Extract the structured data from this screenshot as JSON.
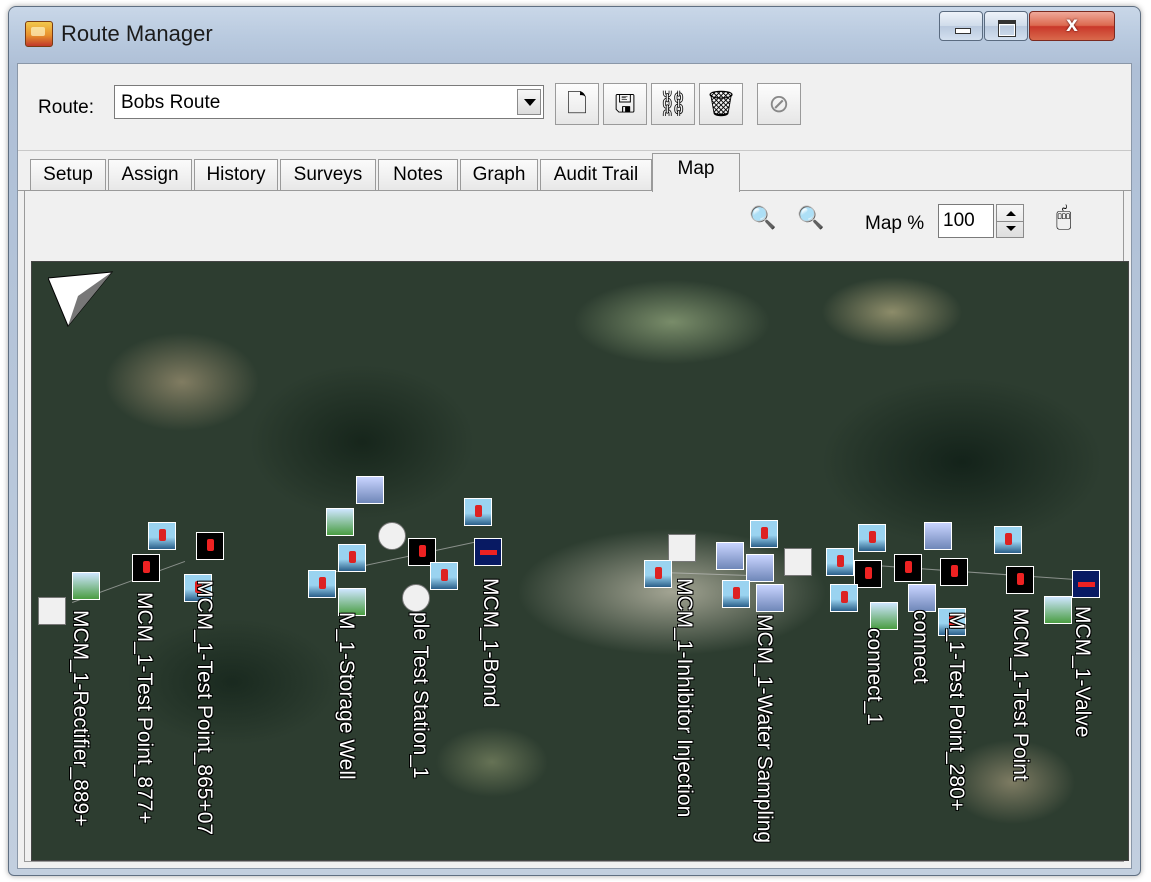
{
  "window": {
    "title": "Route Manager",
    "close_glyph": "x"
  },
  "toolbar": {
    "route_label": "Route:",
    "route_value": "Bobs Route",
    "buttons": [
      {
        "name": "new-route-button",
        "icon": "new-document-icon",
        "glyph": "🗋"
      },
      {
        "name": "save-route-button",
        "icon": "save-icon",
        "glyph": "🖫"
      },
      {
        "name": "assign-route-button",
        "icon": "assign-icon",
        "glyph": "⛓"
      },
      {
        "name": "delete-route-button",
        "icon": "trash-icon",
        "glyph": "🗑"
      },
      {
        "name": "disabled-route-button",
        "icon": "disabled-icon",
        "glyph": "⊘"
      }
    ]
  },
  "tabs": [
    {
      "label": "Setup"
    },
    {
      "label": "Assign"
    },
    {
      "label": "History"
    },
    {
      "label": "Surveys"
    },
    {
      "label": "Notes"
    },
    {
      "label": "Graph"
    },
    {
      "label": "Audit Trail"
    },
    {
      "label": "Map",
      "active": true
    }
  ],
  "map_toolbar": {
    "zoom_in_glyph": "🔍",
    "zoom_out_glyph": "🔍",
    "map_percent_label": "Map %",
    "map_percent_value": "100",
    "select_glyph": "🖱"
  },
  "map": {
    "labels": [
      "MCM_1-Rectifier_889+",
      "MCM_1-Test Point_877+",
      "MCM_1-Test Point_865+07",
      "M_1-Storage Well",
      "ple Test Station_1",
      "MCM_1-Bond",
      "MCM_1-Inhibitor Injection",
      "MCM_1-Water Sampling",
      "connect_1",
      "connect",
      "M_1-Test Point_280+",
      "MCM_1-Test Point",
      "MCM_1-Valve"
    ]
  }
}
